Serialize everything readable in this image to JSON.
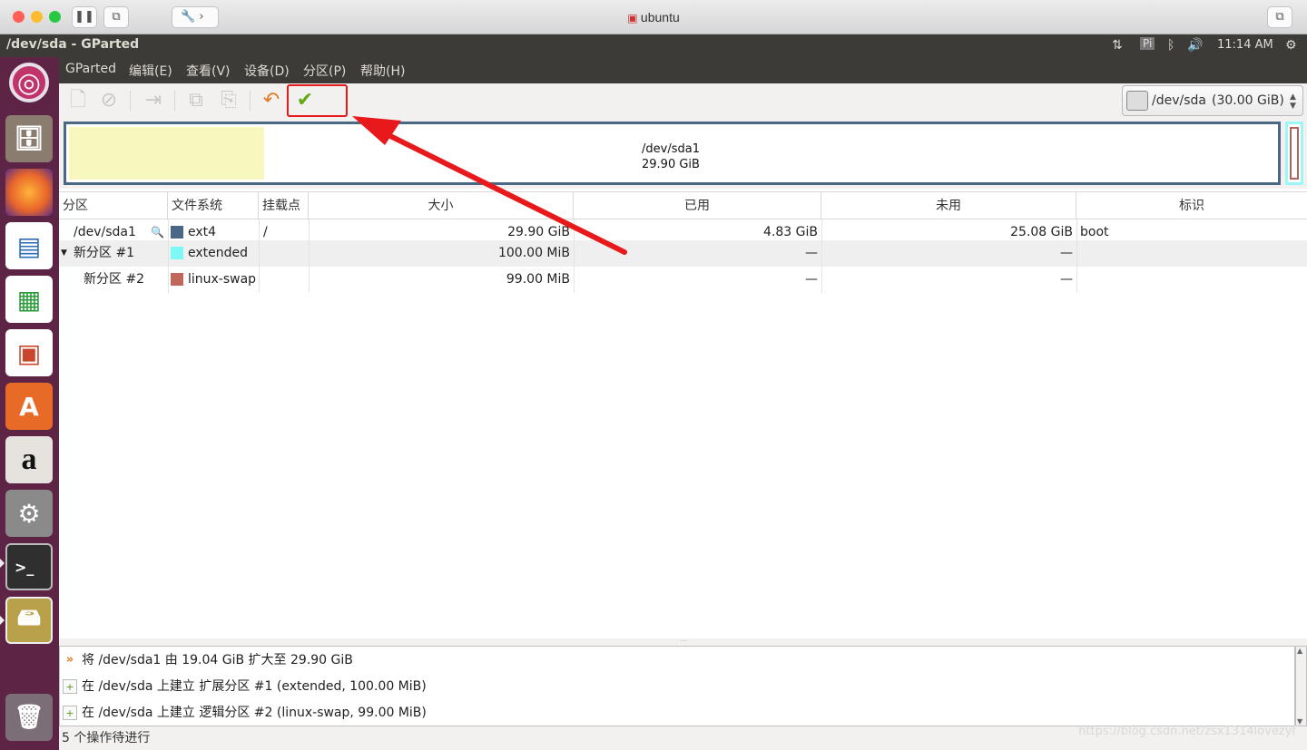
{
  "vm": {
    "title": "ubuntu",
    "traffic_colors": [
      "#fe5f57",
      "#febc2e",
      "#28c840"
    ]
  },
  "window": {
    "title": "/dev/sda - GParted",
    "indicators": {
      "net": "⇅",
      "keyboard": "Pi",
      "bluetooth": "ᛒ",
      "volume": "🔊",
      "time": "11:14 AM",
      "settings": "⚙"
    }
  },
  "launcher": {
    "items": [
      {
        "name": "ubuntu-dash-icon",
        "color": "#c1336b"
      },
      {
        "name": "files-icon",
        "color": "#8a7d70"
      },
      {
        "name": "firefox-icon",
        "color": "#e8662a"
      },
      {
        "name": "libreoffice-writer-icon",
        "color": "#2f6bb4"
      },
      {
        "name": "libreoffice-calc-icon",
        "color": "#2a9a3a"
      },
      {
        "name": "libreoffice-impress-icon",
        "color": "#c9462c"
      },
      {
        "name": "software-center-icon",
        "color": "#e86a27"
      },
      {
        "name": "amazon-icon",
        "color": "#e6e3de"
      },
      {
        "name": "system-settings-icon",
        "color": "#9a9a9a"
      },
      {
        "name": "terminal-icon",
        "color": "#2f2f2f"
      },
      {
        "name": "gparted-icon",
        "color": "#b8a14a"
      },
      {
        "name": "trash-icon",
        "color": "#7b6e76"
      }
    ]
  },
  "menu": {
    "items": [
      "GParted",
      "编辑(E)",
      "查看(V)",
      "设备(D)",
      "分区(P)",
      "帮助(H)"
    ]
  },
  "toolbar": {
    "device_label": "/dev/sda",
    "device_size": "(30.00 GiB)",
    "apply_color": "#63a815",
    "undo_color": "#e07a1f"
  },
  "map": {
    "partition_name": "/dev/sda1",
    "partition_size": "29.90 GiB"
  },
  "table": {
    "headers": [
      "分区",
      "文件系统",
      "挂载点",
      "大小",
      "已用",
      "未用",
      "标识"
    ],
    "rows": [
      {
        "partition": "/dev/sda1",
        "fs": "ext4",
        "fs_color": "#4a6785",
        "mount": "/",
        "size": "29.90 GiB",
        "used": "4.83 GiB",
        "unused": "25.08 GiB",
        "flags": "boot"
      },
      {
        "partition": "新分区 #1",
        "fs": "extended",
        "fs_color": "#7ef7f7",
        "mount": "",
        "size": "100.00 MiB",
        "used": "—",
        "unused": "—",
        "flags": ""
      },
      {
        "partition": "新分区 #2",
        "fs": "linux-swap",
        "fs_color": "#c1665a",
        "mount": "",
        "size": "99.00 MiB",
        "used": "—",
        "unused": "—",
        "flags": ""
      }
    ]
  },
  "operations": [
    "将 /dev/sda1 由 19.04 GiB 扩大至 29.90 GiB",
    "在 /dev/sda 上建立 扩展分区 #1 (extended, 100.00 MiB)",
    "在 /dev/sda 上建立 逻辑分区 #2 (linux-swap, 99.00 MiB)"
  ],
  "status": "5 个操作待进行",
  "watermark": "https://blog.csdn.net/zsx1314lovezyf",
  "annotation": {
    "color": "#e8191b"
  }
}
